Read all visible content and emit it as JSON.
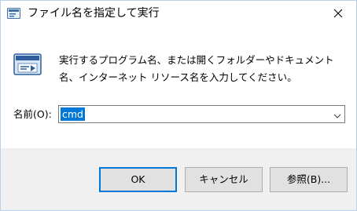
{
  "window": {
    "title": "ファイル名を指定して実行"
  },
  "dialog": {
    "description": "実行するプログラム名、または開くフォルダーやドキュメント名、インターネット リソース名を入力してください。",
    "name_label": "名前(O):",
    "input_value": "cmd"
  },
  "buttons": {
    "ok": "OK",
    "cancel": "キャンセル",
    "browse": "参照(B)..."
  },
  "icons": {
    "title": "run-icon",
    "main": "run-icon",
    "close": "close-icon",
    "dropdown": "chevron-down-icon"
  },
  "colors": {
    "accent": "#0078d7",
    "footer_bg": "#f0f0f0",
    "button_bg": "#e1e1e1",
    "button_border": "#adadad"
  }
}
